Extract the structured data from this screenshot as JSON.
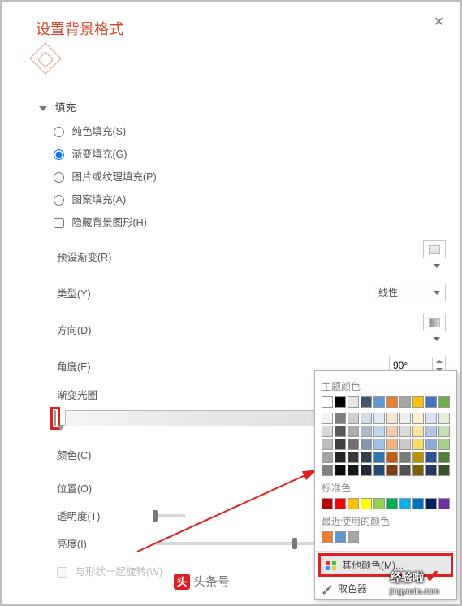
{
  "title": "设置背景格式",
  "fill": {
    "section": "填充",
    "solid": "纯色填充(S)",
    "gradient": "渐变填充(G)",
    "picture": "图片或纹理填充(P)",
    "pattern": "图案填充(A)",
    "hide": "隐藏背景图形(H)"
  },
  "labels": {
    "preset": "预设渐变(R)",
    "type": "类型(Y)",
    "direction": "方向(D)",
    "angle": "角度(E)",
    "stops": "渐变光圈",
    "color": "颜色(C)",
    "position": "位置(O)",
    "transparency": "透明度(T)",
    "brightness": "亮度(I)",
    "rotate": "与形状一起旋转(W)"
  },
  "values": {
    "type": "线性",
    "angle": "90°"
  },
  "popup": {
    "theme": "主题颜色",
    "standard": "标准色",
    "recent": "最近使用的颜色",
    "more": "其他颜色(M)...",
    "eyedropper": "取色器"
  },
  "colors": {
    "themeTop": [
      "#ffffff",
      "#000000",
      "#e7e6e6",
      "#44546a",
      "#5b9bd5",
      "#ed7d31",
      "#a5a5a5",
      "#ffc000",
      "#4472c4",
      "#70ad47"
    ],
    "themeShades": [
      [
        "#f2f2f2",
        "#7f7f7f",
        "#d0cece",
        "#d6dce4",
        "#deebf6",
        "#fbe5d5",
        "#ededed",
        "#fff2cc",
        "#d9e2f3",
        "#e2efd9"
      ],
      [
        "#d8d8d8",
        "#595959",
        "#aeabab",
        "#adb9ca",
        "#bdd7ee",
        "#f7cbac",
        "#dbdbdb",
        "#fee599",
        "#b4c6e7",
        "#c5e0b3"
      ],
      [
        "#bfbfbf",
        "#3f3f3f",
        "#757070",
        "#8496b0",
        "#9cc3e5",
        "#f4b183",
        "#c9c9c9",
        "#ffd965",
        "#8eaadb",
        "#a8d08d"
      ],
      [
        "#a5a5a5",
        "#262626",
        "#3a3838",
        "#323f4f",
        "#2e75b5",
        "#c55a11",
        "#7b7b7b",
        "#bf9000",
        "#2f5496",
        "#538135"
      ],
      [
        "#7f7f7f",
        "#0c0c0c",
        "#171616",
        "#222a35",
        "#1e4e79",
        "#833c0b",
        "#525252",
        "#7f6000",
        "#1f3864",
        "#375623"
      ]
    ],
    "standard": [
      "#c00000",
      "#ff0000",
      "#ffc000",
      "#ffff00",
      "#92d050",
      "#00b050",
      "#00b0f0",
      "#0070c0",
      "#002060",
      "#7030a0"
    ],
    "recent": [
      "#ed7d31",
      "#5b9bd5",
      "#a5a5a5"
    ]
  },
  "footer": {
    "toutiao": "头条号",
    "logo": "经验啦",
    "site": "jingyanla.com"
  }
}
